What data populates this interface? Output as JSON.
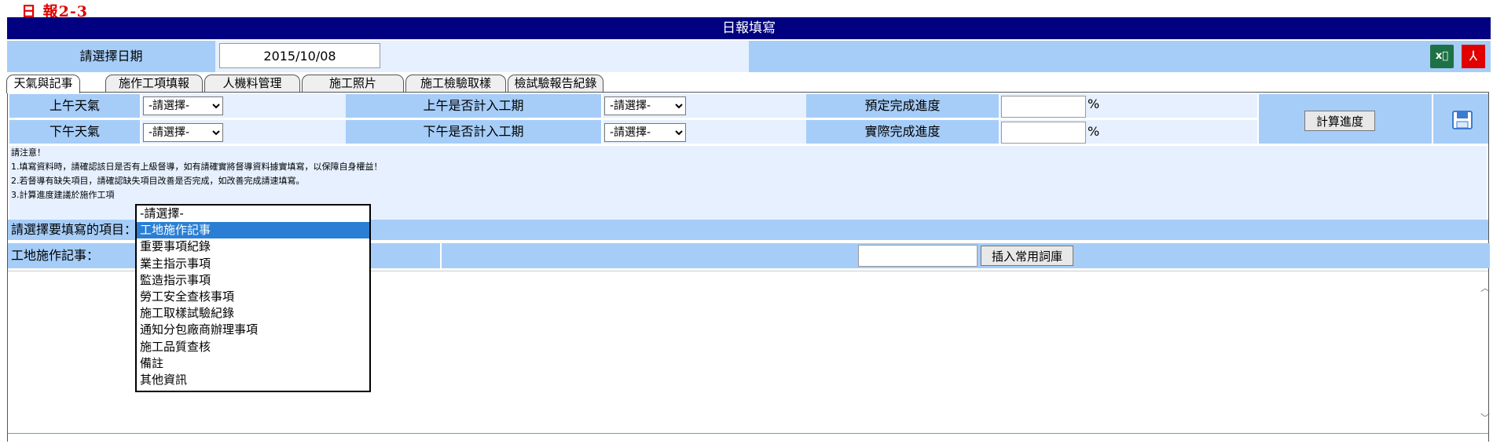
{
  "page_code": "日 報2-3",
  "title": "日報填寫",
  "date": {
    "label": "請選擇日期",
    "value": "2015/10/08"
  },
  "export": {
    "excel_label": "x⃞",
    "pdf_label": "⅄"
  },
  "tabs": [
    {
      "label": "天氣與記事",
      "active": true
    },
    {
      "label": "施作工項填報"
    },
    {
      "label": "人機料管理"
    },
    {
      "label": "施工照片"
    },
    {
      "label": "施工檢驗取樣"
    },
    {
      "label": "檢試驗報告紀錄"
    }
  ],
  "weather": {
    "am_label": "上午天氣",
    "pm_label": "下午天氣",
    "am_value": "-請選擇-",
    "pm_value": "-請選擇-",
    "am_count_label": "上午是否計入工期",
    "pm_count_label": "下午是否計入工期",
    "am_count_value": "-請選擇-",
    "pm_count_value": "-請選擇-",
    "planned_label": "預定完成進度",
    "actual_label": "實際完成進度",
    "percent": "%",
    "calc_button": "計算進度"
  },
  "notes": [
    "請注意！",
    "1.填寫資料時，請確認該日是否有上級督導，如有請確實將督導資料據實填寫，以保障自身權益！",
    "2.若督導有缺失項目，請確認缺失項目改善是否完成，如改善完成請速填寫。",
    "3.計算進度建議於施作工項"
  ],
  "project": {
    "label": "請選擇要填寫的項目："
  },
  "site": {
    "label": "工地施作記事：",
    "insert_button": "插入常用詞庫"
  },
  "dropdown": {
    "options": [
      "-請選擇-",
      "工地施作記事",
      "重要事項紀錄",
      "業主指示事項",
      "監造指示事項",
      "勞工安全查核事項",
      "施工取樣試驗紀錄",
      "通知分包廠商辦理事項",
      "施工品質查核",
      "備註",
      "其他資訊"
    ],
    "selected_index": 1
  }
}
